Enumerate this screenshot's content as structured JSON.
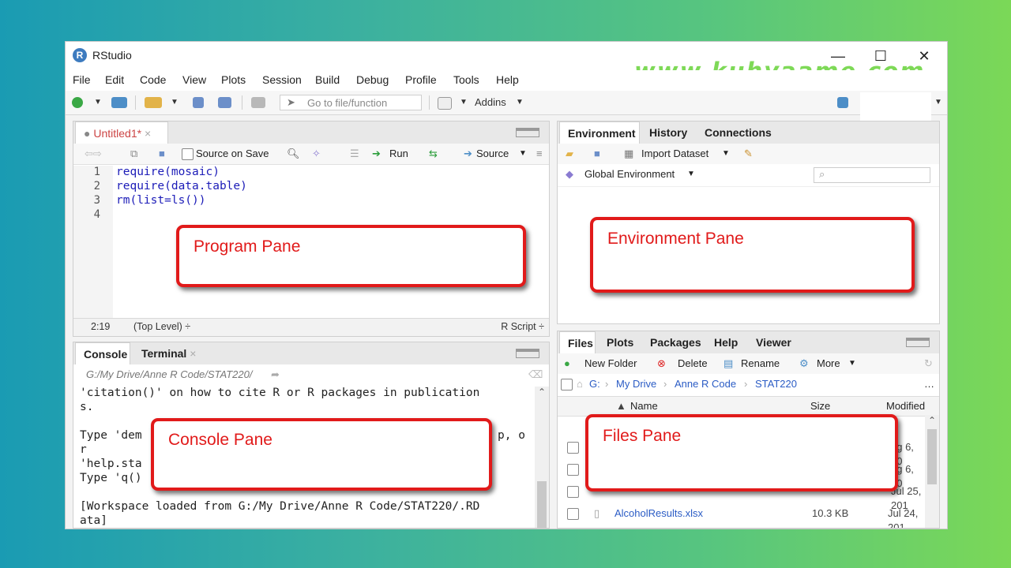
{
  "window": {
    "title": "RStudio",
    "watermark": "www.kuhyaame.com"
  },
  "menu": [
    "File",
    "Edit",
    "Code",
    "View",
    "Plots",
    "Session",
    "Build",
    "Debug",
    "Profile",
    "Tools",
    "Help"
  ],
  "toolbar": {
    "goto_placeholder": "Go to file/function",
    "addins": "Addins"
  },
  "source": {
    "tab": "Untitled1*",
    "source_on_save": "Source on Save",
    "run": "Run",
    "source": "Source",
    "lines": [
      "1",
      "2",
      "3",
      "4"
    ],
    "code": [
      "require(mosaic)",
      "require(data.table)",
      "rm(list=ls())",
      ""
    ],
    "status_pos": "2:19",
    "status_level": "(Top Level) ÷",
    "status_type": "R Script ÷",
    "callout": "Program Pane"
  },
  "env": {
    "tabs": [
      "Environment",
      "History",
      "Connections"
    ],
    "import": "Import Dataset",
    "global": "Global Environment",
    "callout": "Environment Pane"
  },
  "console": {
    "tabs": [
      "Console",
      "Terminal"
    ],
    "path": "G:/My Drive/Anne R Code/STAT220/",
    "lines": [
      "'citation()' on how to cite R or R packages in publication",
      "s.",
      "",
      "Type 'dem",
      "r",
      "'help.sta",
      "Type 'q()",
      "",
      "[Workspace loaded from G:/My Drive/Anne R Code/STAT220/.RD",
      "ata]"
    ],
    "line4_tail": "p, o",
    "callout": "Console Pane"
  },
  "files": {
    "tabs": [
      "Files",
      "Plots",
      "Packages",
      "Help",
      "Viewer"
    ],
    "new_folder": "New Folder",
    "delete": "Delete",
    "rename": "Rename",
    "more": "More",
    "breadcrumb": [
      "G:",
      "My Drive",
      "Anne R Code",
      "STAT220"
    ],
    "columns": [
      "Name",
      "Size",
      "Modified"
    ],
    "rows": [
      {
        "name": "",
        "size": "",
        "modified": "ug 6, 20"
      },
      {
        "name": "",
        "size": "",
        "modified": "ug 6, 20"
      },
      {
        "name": "",
        "size": "",
        "modified": "Jul 25, 201"
      },
      {
        "name": "AlcoholResults.xlsx",
        "size": "10.3 KB",
        "modified": "Jul 24, 201"
      }
    ],
    "callout": "Files Pane"
  }
}
